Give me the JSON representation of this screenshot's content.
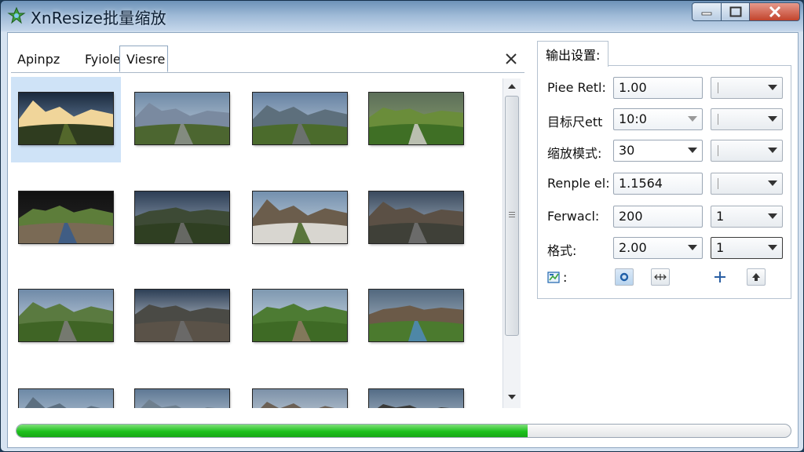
{
  "window": {
    "title": "XnResize批量缩放"
  },
  "tabs": [
    {
      "label": "Apinpz",
      "active": false
    },
    {
      "label": "Fyiole",
      "active": false
    },
    {
      "label": "Viesre",
      "active": true
    }
  ],
  "thumbnails": [
    {
      "scene": "sunset-valley",
      "selected": true
    },
    {
      "scene": "mountain-road",
      "selected": false
    },
    {
      "scene": "mountain-road-curve",
      "selected": false
    },
    {
      "scene": "guardrail-meadow",
      "selected": false
    },
    {
      "scene": "tilted-ruins",
      "selected": false
    },
    {
      "scene": "dark-valley-road",
      "selected": false
    },
    {
      "scene": "ruined-building-hill",
      "selected": false
    },
    {
      "scene": "ruined-town-road",
      "selected": false
    },
    {
      "scene": "green-mountain-road",
      "selected": false
    },
    {
      "scene": "cliff-road-sun",
      "selected": false
    },
    {
      "scene": "meadow-stream",
      "selected": false
    },
    {
      "scene": "ruins-by-water",
      "selected": false
    },
    {
      "scene": "mountain-peaks",
      "selected": false
    },
    {
      "scene": "cloudy-peaks",
      "selected": false
    },
    {
      "scene": "rock-overhang",
      "selected": false
    },
    {
      "scene": "dark-peak",
      "selected": false
    }
  ],
  "output_settings": {
    "tab_label": "输出设置:",
    "rows": [
      {
        "label": "Piee Retl:",
        "value": "1.00",
        "style": "plain-box",
        "arrow": false,
        "combo2_value": ""
      },
      {
        "label": "目标尺ett",
        "value": "10:0",
        "style": "combo",
        "arrow": true,
        "arrow_light": true,
        "combo2_value": ""
      },
      {
        "label": "缩放模式:",
        "value": "30",
        "style": "combo-white",
        "arrow": true,
        "arrow_light": false,
        "combo2_value": ""
      },
      {
        "label": "Renple el:",
        "value": "1.1564",
        "style": "plain-box",
        "arrow": false,
        "combo2_value": ""
      },
      {
        "label": "Ferwacl:",
        "value": "200",
        "style": "plain-box",
        "arrow": false,
        "combo2_value": "1"
      },
      {
        "label": "格式:",
        "value": "2.00",
        "style": "combo",
        "arrow": true,
        "arrow_light": false,
        "combo2_value": "1"
      }
    ],
    "icon_row_label": ":"
  },
  "progress": {
    "percent": 66
  },
  "colors": {
    "progress_green": "#1ec11d",
    "selection": "#cfe3f7",
    "close_red": "#c2432c"
  }
}
